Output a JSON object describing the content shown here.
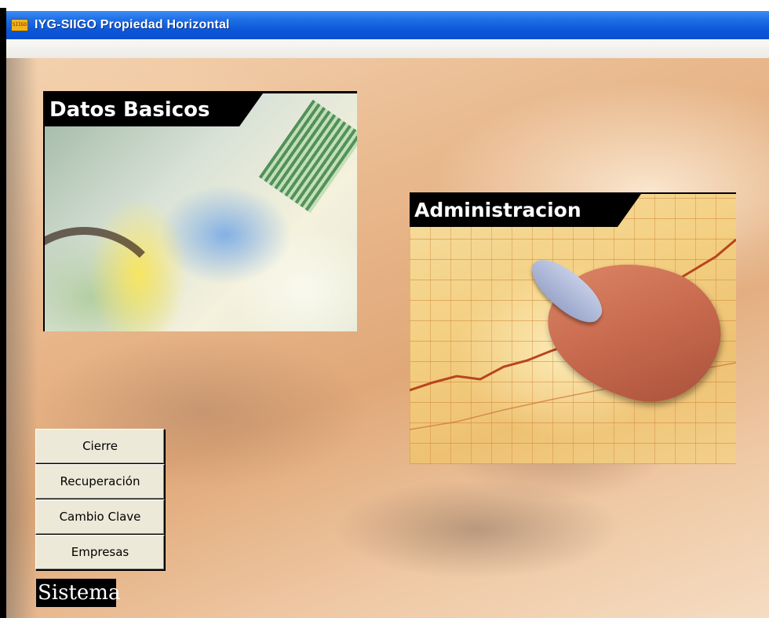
{
  "window": {
    "title": "IYG-SIIGO Propiedad Horizontal",
    "icon_text": "SIIGO"
  },
  "panels": {
    "datos_basicos": {
      "label": "Datos Basicos"
    },
    "administracion": {
      "label": "Administracion"
    }
  },
  "sistema": {
    "label": "Sistema",
    "buttons": [
      {
        "label": "Cierre"
      },
      {
        "label": "Recuperación"
      },
      {
        "label": "Cambio Clave"
      },
      {
        "label": "Empresas"
      }
    ]
  },
  "colors": {
    "titlebar": "#0a56d8",
    "button_face": "#ece9d8"
  }
}
